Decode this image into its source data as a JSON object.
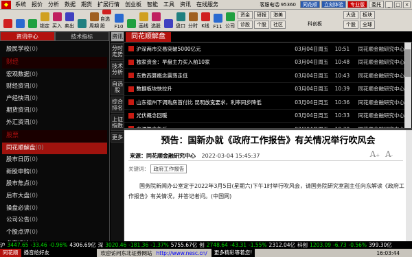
{
  "menu": {
    "items": [
      "系统",
      "报价",
      "分析",
      "数据",
      "期货",
      "扩展行情",
      "创业板",
      "智能",
      "工具",
      "资讯",
      "在线服务"
    ],
    "account": "客服电话:95360",
    "buttons": [
      "同花顺",
      "立刻体验",
      "专业版",
      "委托"
    ],
    "win": [
      "_",
      "□",
      "×"
    ]
  },
  "toolbar": {
    "buttons": [
      "",
      "",
      "",
      "锁定",
      "买入",
      "卖出",
      "",
      "周期",
      "自选股",
      "F10",
      "",
      "画线",
      "选股",
      "",
      "盘口",
      "分时",
      "K线",
      "F11",
      "公司",
      "公式",
      "",
      "",
      "",
      "",
      "BBD",
      "",
      "",
      ""
    ],
    "right": [
      "资金",
      "研报",
      "港美",
      "诊股",
      "个股",
      "社区",
      "科创板",
      "",
      "大盘",
      "板块",
      "个股",
      "全球"
    ]
  },
  "left": {
    "tabs": [
      "资讯中心",
      "技术指标"
    ],
    "items": [
      {
        "label": "股民学校",
        "count": "(0)",
        "type": "item"
      },
      {
        "label": "财经",
        "count": "",
        "type": "header"
      },
      {
        "label": "宏观数据",
        "count": "(0)",
        "type": "item"
      },
      {
        "label": "财经资讯",
        "count": "(0)",
        "type": "item"
      },
      {
        "label": "产经快讯",
        "count": "(0)",
        "type": "item"
      },
      {
        "label": "期货资讯",
        "count": "(0)",
        "type": "item"
      },
      {
        "label": "外汇资讯",
        "count": "(0)",
        "type": "item"
      },
      {
        "label": "股票",
        "count": "",
        "type": "header"
      },
      {
        "label": "同花顺解盘",
        "count": "(0)",
        "type": "sel"
      },
      {
        "label": "股市日历",
        "count": "(0)",
        "type": "item"
      },
      {
        "label": "新股申购",
        "count": "(0)",
        "type": "item"
      },
      {
        "label": "股市焦点",
        "count": "(0)",
        "type": "item"
      },
      {
        "label": "后市大盘",
        "count": "(0)",
        "type": "item"
      },
      {
        "label": "操盘必读",
        "count": "(0)",
        "type": "item"
      },
      {
        "label": "公司公告",
        "count": "(0)",
        "type": "item"
      },
      {
        "label": "个股点评",
        "count": "(0)",
        "type": "item"
      },
      {
        "label": "名家评论",
        "count": "(0)",
        "type": "item"
      }
    ]
  },
  "vtabs": [
    "资讯",
    "分时走势",
    "技术分析",
    "自选股",
    "综合排名",
    "上证指数",
    "更多"
  ],
  "news": {
    "title": "同花顺解盘",
    "rows": [
      {
        "t": "沪深两市交易突破5000亿元",
        "d": "03月04日周五",
        "tm": "10:51",
        "src": "同花顺金融研究中心"
      },
      {
        "t": "独家资金：早盘主力买入前10家",
        "d": "03月04日周五",
        "tm": "10:48",
        "src": "同花顺金融研究中心"
      },
      {
        "t": "东数西算概念震荡走低",
        "d": "03月04日周五",
        "tm": "10:43",
        "src": "同花顺金融研究中心"
      },
      {
        "t": "数据板块快拉升",
        "d": "03月04日周五",
        "tm": "10:39",
        "src": "同花顺金融研究中心"
      },
      {
        "t": "山东德州下调购房首付比 昆明放宽要求，利率同步降低",
        "d": "03月04日周五",
        "tm": "10:36",
        "src": "同花顺金融研究中心"
      },
      {
        "t": "光伏概念回暖",
        "d": "03月04日周五",
        "tm": "10:33",
        "src": "同花顺金融研究中心"
      },
      {
        "t": "白酒概念午后",
        "d": "03月04日周五",
        "tm": "10:30",
        "src": "同花顺金融研究中心"
      }
    ]
  },
  "article": {
    "title": "预告：国新办就《政府工作报告》有关情况举行吹风会",
    "source": "来源：同花顺金融研究中心",
    "date": "2022-03-04 15:45:37",
    "font_big": "A",
    "font_small": "A",
    "keyword_label": "关键词：",
    "keyword": "政府工作报告",
    "body": "国务院新闻办公室定于2022年3月5日(星期六)下午1时举行吹风会，请国务院研究室副主任向东解读《政府工作报告》有关情况，并答记者问。(中国网)"
  },
  "ticker": [
    {
      "t": "沪",
      "c": "w"
    },
    {
      "t": "3447.65",
      "c": "g"
    },
    {
      "t": "-33.46",
      "c": "g"
    },
    {
      "t": "-0.96%",
      "c": "g"
    },
    {
      "t": "4306.69亿",
      "c": "w"
    },
    {
      "t": "深",
      "c": "w"
    },
    {
      "t": "3020.46",
      "c": "g"
    },
    {
      "t": "-181.36",
      "c": "g"
    },
    {
      "t": "-1.37%",
      "c": "g"
    },
    {
      "t": "5755.67亿",
      "c": "w"
    },
    {
      "t": "创",
      "c": "w"
    },
    {
      "t": "2748.64",
      "c": "g"
    },
    {
      "t": "-43.31",
      "c": "g"
    },
    {
      "t": "-1.55%",
      "c": "g"
    },
    {
      "t": "2312.04亿",
      "c": "w"
    },
    {
      "t": "科创",
      "c": "w"
    },
    {
      "t": "1203.09",
      "c": "g"
    },
    {
      "t": "-6.73",
      "c": "g"
    },
    {
      "t": "-0.56%",
      "c": "g"
    },
    {
      "t": "399.30亿",
      "c": "w"
    }
  ],
  "status": {
    "logo": "同花顺",
    "left": "播音给好友",
    "mid": "欢迎访问东北证券网站",
    "url": "http://www.nesc.cn/",
    "right": "更多精彩等着您!",
    "time": "16:03:44"
  },
  "colors": {
    "accent": "#b3120e",
    "up": "#ff4a4a",
    "down": "#00e000"
  }
}
